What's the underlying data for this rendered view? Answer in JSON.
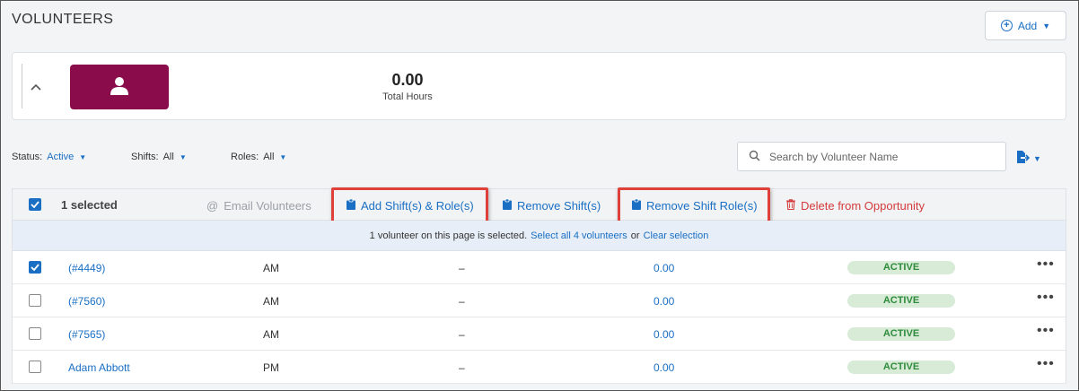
{
  "page": {
    "title": "VOLUNTEERS"
  },
  "header": {
    "add_label": "Add"
  },
  "summary": {
    "hours_value": "0.00",
    "hours_label": "Total Hours"
  },
  "filters": [
    {
      "label": "Status:",
      "value": "Active"
    },
    {
      "label": "Shifts:",
      "value": "All"
    },
    {
      "label": "Roles:",
      "value": "All"
    }
  ],
  "search": {
    "placeholder": "Search by Volunteer Name"
  },
  "bulk": {
    "selected_count": "1 selected",
    "email": "Email Volunteers",
    "add_shift_roles": "Add Shift(s) & Role(s)",
    "remove_shifts": "Remove Shift(s)",
    "remove_shift_roles": "Remove Shift Role(s)",
    "delete": "Delete from Opportunity"
  },
  "notice": {
    "text": "1 volunteer on this page is selected.",
    "select_all": "Select all 4 volunteers",
    "or": "or",
    "clear": "Clear selection"
  },
  "rows": [
    {
      "name": "(#4449)",
      "shift": "AM",
      "role": "–",
      "hours": "0.00",
      "status": "ACTIVE",
      "checked": true
    },
    {
      "name": "(#7560)",
      "shift": "AM",
      "role": "–",
      "hours": "0.00",
      "status": "ACTIVE",
      "checked": false
    },
    {
      "name": "(#7565)",
      "shift": "AM",
      "role": "–",
      "hours": "0.00",
      "status": "ACTIVE",
      "checked": false
    },
    {
      "name": "Adam Abbott",
      "shift": "PM",
      "role": "–",
      "hours": "0.00",
      "status": "ACTIVE",
      "checked": false
    }
  ],
  "more_glyph": "•••",
  "colors": {
    "accent": "#1a6fc4",
    "brand_tile": "#8b0c4b",
    "danger": "#d43b3b",
    "active_bg": "#d7ebd7",
    "active_text": "#2e8b3b",
    "highlight": "#e0403a"
  }
}
